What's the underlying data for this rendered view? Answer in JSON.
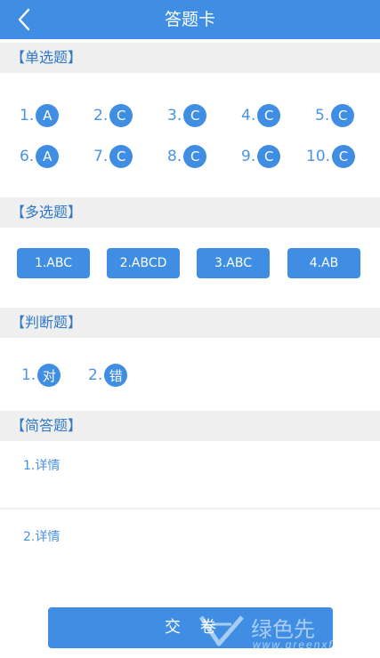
{
  "header": {
    "title": "答题卡"
  },
  "single": {
    "heading": "【单选题】",
    "items": [
      {
        "num": "1.",
        "ans": "A"
      },
      {
        "num": "2.",
        "ans": "C"
      },
      {
        "num": "3.",
        "ans": "C"
      },
      {
        "num": "4.",
        "ans": "C"
      },
      {
        "num": "5.",
        "ans": "C"
      },
      {
        "num": "6.",
        "ans": "A"
      },
      {
        "num": "7.",
        "ans": "C"
      },
      {
        "num": "8.",
        "ans": "C"
      },
      {
        "num": "9.",
        "ans": "C"
      },
      {
        "num": "10.",
        "ans": "C"
      }
    ]
  },
  "multi": {
    "heading": "【多选题】",
    "items": [
      "1.ABC",
      "2.ABCD",
      "3.ABC",
      "4.AB"
    ]
  },
  "judge": {
    "heading": "【判断题】",
    "items": [
      {
        "num": "1.",
        "ans": "对"
      },
      {
        "num": "2.",
        "ans": "错"
      }
    ]
  },
  "short": {
    "heading": "【简答题】",
    "items": [
      "1.详情",
      "2.详情"
    ]
  },
  "submit_label": "交卷",
  "watermark": {
    "text": "绿色先",
    "sub": "www.greenxf"
  },
  "colors": {
    "primary": "#3f8ee3",
    "section_bg": "#efefef"
  }
}
